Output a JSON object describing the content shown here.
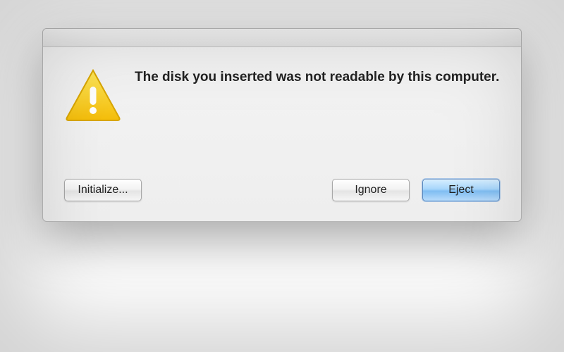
{
  "dialog": {
    "icon_name": "warning-triangle-icon",
    "message": "The disk you inserted was not readable by this computer.",
    "buttons": {
      "initialize": "Initialize...",
      "ignore": "Ignore",
      "eject": "Eject"
    }
  },
  "colors": {
    "warning_fill": "#f8cb1c",
    "warning_border": "#e0b400",
    "default_button_tint": "#a7d6fb"
  }
}
